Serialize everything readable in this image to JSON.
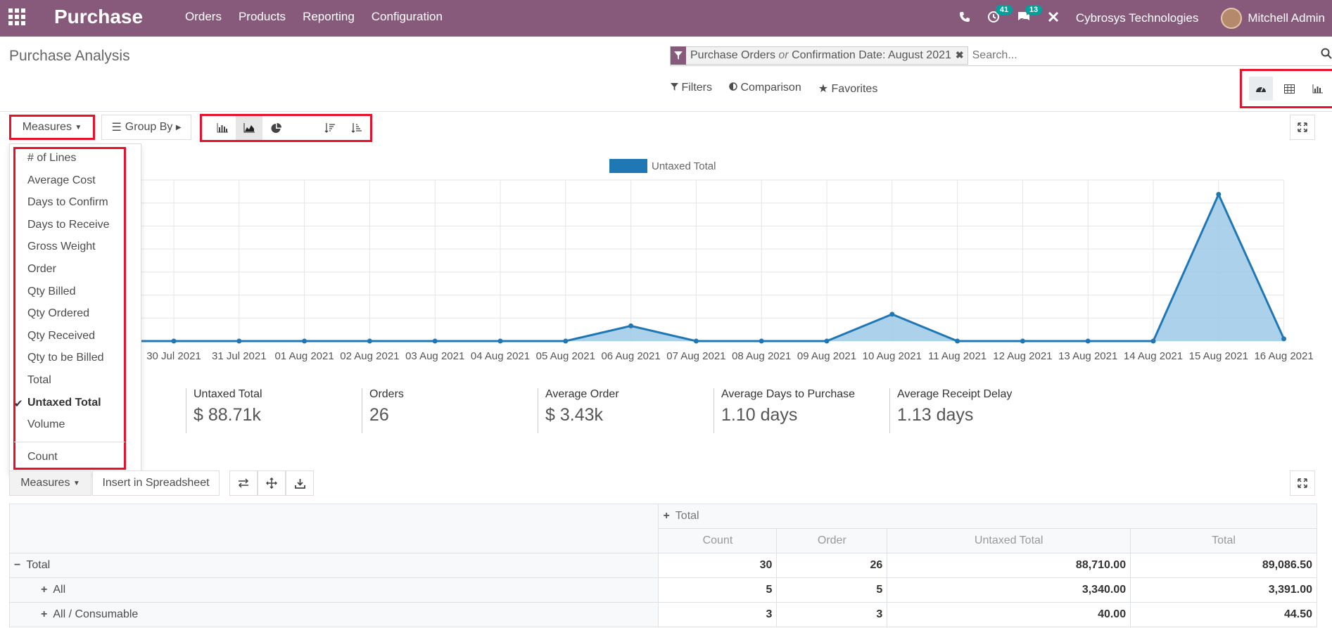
{
  "navbar": {
    "app_name": "Purchase",
    "menu": [
      "Orders",
      "Products",
      "Reporting",
      "Configuration"
    ],
    "activity_badge": "41",
    "message_badge": "13",
    "company": "Cybrosys Technologies",
    "user": "Mitchell Admin"
  },
  "control_panel": {
    "breadcrumb": "Purchase Analysis",
    "facet_part1": "Purchase Orders",
    "facet_or": "or",
    "facet_part2": "Confirmation Date: August 2021",
    "search_placeholder": "Search...",
    "filters_label": "Filters",
    "comparison_label": "Comparison",
    "favorites_label": "Favorites"
  },
  "graph_toolbar": {
    "measures_label": "Measures",
    "groupby_label": "Group By"
  },
  "measures_menu": {
    "items": [
      "# of Lines",
      "Average Cost",
      "Days to Confirm",
      "Days to Receive",
      "Gross Weight",
      "Order",
      "Qty Billed",
      "Qty Ordered",
      "Qty Received",
      "Qty to be Billed",
      "Total",
      "Untaxed Total",
      "Volume",
      "Count"
    ],
    "checked": "Untaxed Total"
  },
  "chart_data": {
    "type": "area",
    "title": "",
    "xlabel": "",
    "ylabel": "",
    "legend": "Untaxed Total",
    "legend_position": "top-center",
    "grid": true,
    "series_color": "#1f77b4",
    "fill_color": "#9ec9e6",
    "categories": [
      "30 Jul 2021",
      "31 Jul 2021",
      "01 Aug 2021",
      "02 Aug 2021",
      "03 Aug 2021",
      "04 Aug 2021",
      "05 Aug 2021",
      "06 Aug 2021",
      "07 Aug 2021",
      "08 Aug 2021",
      "09 Aug 2021",
      "10 Aug 2021",
      "11 Aug 2021",
      "12 Aug 2021",
      "13 Aug 2021",
      "14 Aug 2021",
      "15 Aug 2021",
      "16 Aug 2021"
    ],
    "series": [
      {
        "name": "Untaxed Total",
        "values": [
          0,
          0,
          0,
          0,
          0,
          0,
          0,
          3400,
          0,
          0,
          0,
          6000,
          0,
          0,
          0,
          0,
          32800,
          500
        ]
      }
    ],
    "ylim": [
      0,
      36000
    ]
  },
  "kpis": [
    {
      "label": "Untaxed Total",
      "value": "$ 88.71k"
    },
    {
      "label": "Orders",
      "value": "26"
    },
    {
      "label": "Average Order",
      "value": "$ 3.43k"
    },
    {
      "label": "Average Days to Purchase",
      "value": "1.10 days"
    },
    {
      "label": "Average Receipt Delay",
      "value": "1.13 days"
    }
  ],
  "pivot_toolbar": {
    "measures_label": "Measures",
    "insert_label": "Insert in Spreadsheet"
  },
  "pivot": {
    "col_group": "Total",
    "columns": [
      "Count",
      "Order",
      "Untaxed Total",
      "Total"
    ],
    "rows": [
      {
        "label": "Total",
        "values": [
          "30",
          "26",
          "88,710.00",
          "89,086.50"
        ]
      },
      {
        "label": "All",
        "values": [
          "5",
          "5",
          "3,340.00",
          "3,391.00"
        ]
      },
      {
        "label": "All / Consumable",
        "values": [
          "3",
          "3",
          "40.00",
          "44.50"
        ]
      }
    ]
  },
  "colors": {
    "brand": "#875a7b",
    "highlight": "#e8102a",
    "badge": "#00a09d"
  }
}
